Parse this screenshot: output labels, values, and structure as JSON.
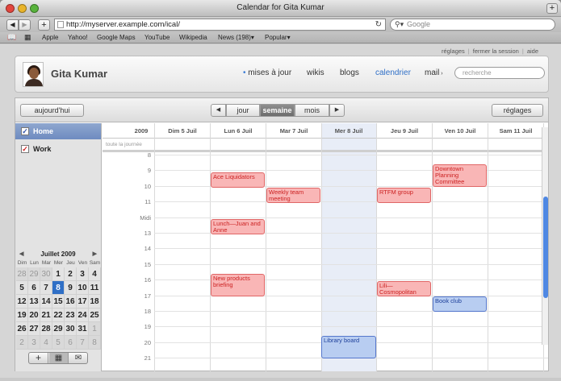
{
  "window": {
    "title": "Calendar for Gita Kumar"
  },
  "browser": {
    "url": "http://myserver.example.com/ical/",
    "search_placeholder": "Google",
    "bookmarks": [
      "Apple",
      "Yahoo!",
      "Google Maps",
      "YouTube",
      "Wikipedia",
      "News (198)▾",
      "Popular▾"
    ]
  },
  "toplinks": {
    "settings": "réglages",
    "logout": "fermer la session",
    "help": "aide"
  },
  "header": {
    "user_name": "Gita Kumar",
    "nav": [
      "mises à jour",
      "wikis",
      "blogs",
      "calendrier",
      "mail"
    ],
    "search_placeholder": "recherche"
  },
  "cal_toolbar": {
    "today": "aujourd'hui",
    "day": "jour",
    "week": "semaine",
    "month": "mois",
    "settings": "réglages"
  },
  "calendars": [
    {
      "label": "Home",
      "color": "#4a6fbf"
    },
    {
      "label": "Work",
      "color": "#d23c3c"
    }
  ],
  "mini_cal": {
    "title": "Juillet 2009",
    "day_names": [
      "Dim",
      "Lun",
      "Mar",
      "Mer",
      "Jeu",
      "Ven",
      "Sam"
    ],
    "weeks": [
      [
        "28",
        "29",
        "30",
        "1",
        "2",
        "3",
        "4"
      ],
      [
        "5",
        "6",
        "7",
        "8",
        "9",
        "10",
        "11"
      ],
      [
        "12",
        "13",
        "14",
        "15",
        "16",
        "17",
        "18"
      ],
      [
        "19",
        "20",
        "21",
        "22",
        "23",
        "24",
        "25"
      ],
      [
        "26",
        "27",
        "28",
        "29",
        "30",
        "31",
        "1"
      ],
      [
        "2",
        "3",
        "4",
        "5",
        "6",
        "7",
        "8"
      ]
    ]
  },
  "week_view": {
    "year": "2009",
    "days": [
      "Dim 5 Juil",
      "Lun 6 Juil",
      "Mar 7 Juil",
      "Mer 8 Juil",
      "Jeu 9 Juil",
      "Ven 10 Juil",
      "Sam 11 Juil"
    ],
    "all_day_label": "toute la journée",
    "hours": [
      "8",
      "9",
      "10",
      "11",
      "Midi",
      "13",
      "14",
      "15",
      "16",
      "17",
      "18",
      "19",
      "20",
      "21"
    ]
  },
  "events": [
    {
      "title": "Ace Liquidators",
      "day": 1,
      "calendar": "Work"
    },
    {
      "title": "Weekly team meeting",
      "day": 2,
      "calendar": "Work"
    },
    {
      "title": "Lunch—Juan and Anne",
      "day": 1,
      "calendar": "Work"
    },
    {
      "title": "New products briefing",
      "day": 1,
      "calendar": "Work"
    },
    {
      "title": "RTFM group",
      "day": 4,
      "calendar": "Work"
    },
    {
      "title": "Lili—Cosmopolitan",
      "day": 4,
      "calendar": "Work"
    },
    {
      "title": "Downtown Planning Committee",
      "day": 5,
      "calendar": "Work"
    },
    {
      "title": "Book club",
      "day": 5,
      "calendar": "Home"
    },
    {
      "title": "Library board",
      "day": 3,
      "calendar": "Home"
    }
  ]
}
